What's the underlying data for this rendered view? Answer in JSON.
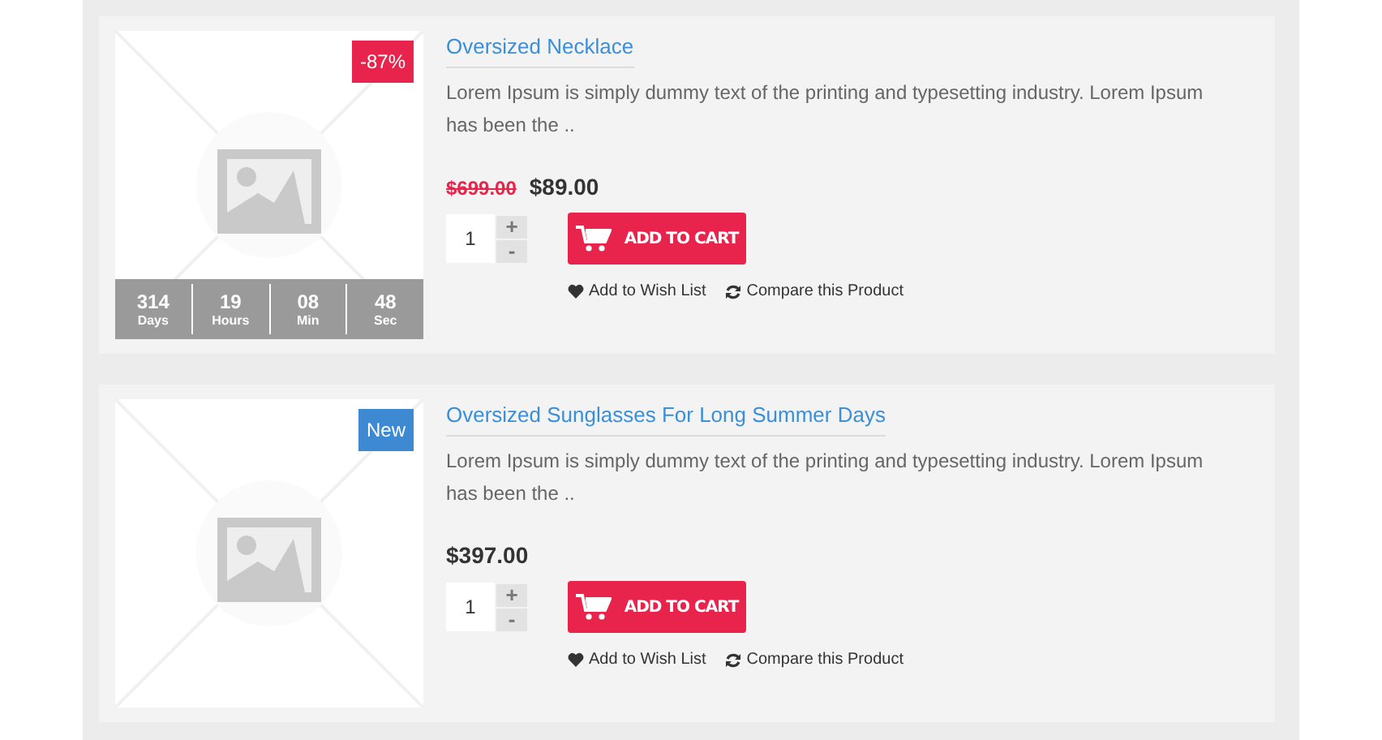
{
  "products": [
    {
      "title": "Oversized Necklace",
      "badge": {
        "kind": "sale",
        "text": "-87%"
      },
      "countdown": [
        {
          "value": "314",
          "unit": "Days"
        },
        {
          "value": "19",
          "unit": "Hours"
        },
        {
          "value": "08",
          "unit": "Min"
        },
        {
          "value": "48",
          "unit": "Sec"
        }
      ],
      "description": "Lorem Ipsum is simply dummy text of the printing and typesetting industry. Lorem Ipsum has been the ..",
      "old_price": "$699.00",
      "price": "$89.00",
      "quantity": "1",
      "plus": "+",
      "minus": "-",
      "cart_button": "ADD TO CART",
      "wishlist": "Add to Wish List",
      "compare": "Compare this Product"
    },
    {
      "title": "Oversized Sunglasses For Long Summer Days",
      "badge": {
        "kind": "new",
        "text": "New"
      },
      "description": "Lorem Ipsum is simply dummy text of the printing and typesetting industry. Lorem Ipsum has been the ..",
      "price": "$397.00",
      "quantity": "1",
      "plus": "+",
      "minus": "-",
      "cart_button": "ADD TO CART",
      "wishlist": "Add to Wish List",
      "compare": "Compare this Product"
    }
  ]
}
